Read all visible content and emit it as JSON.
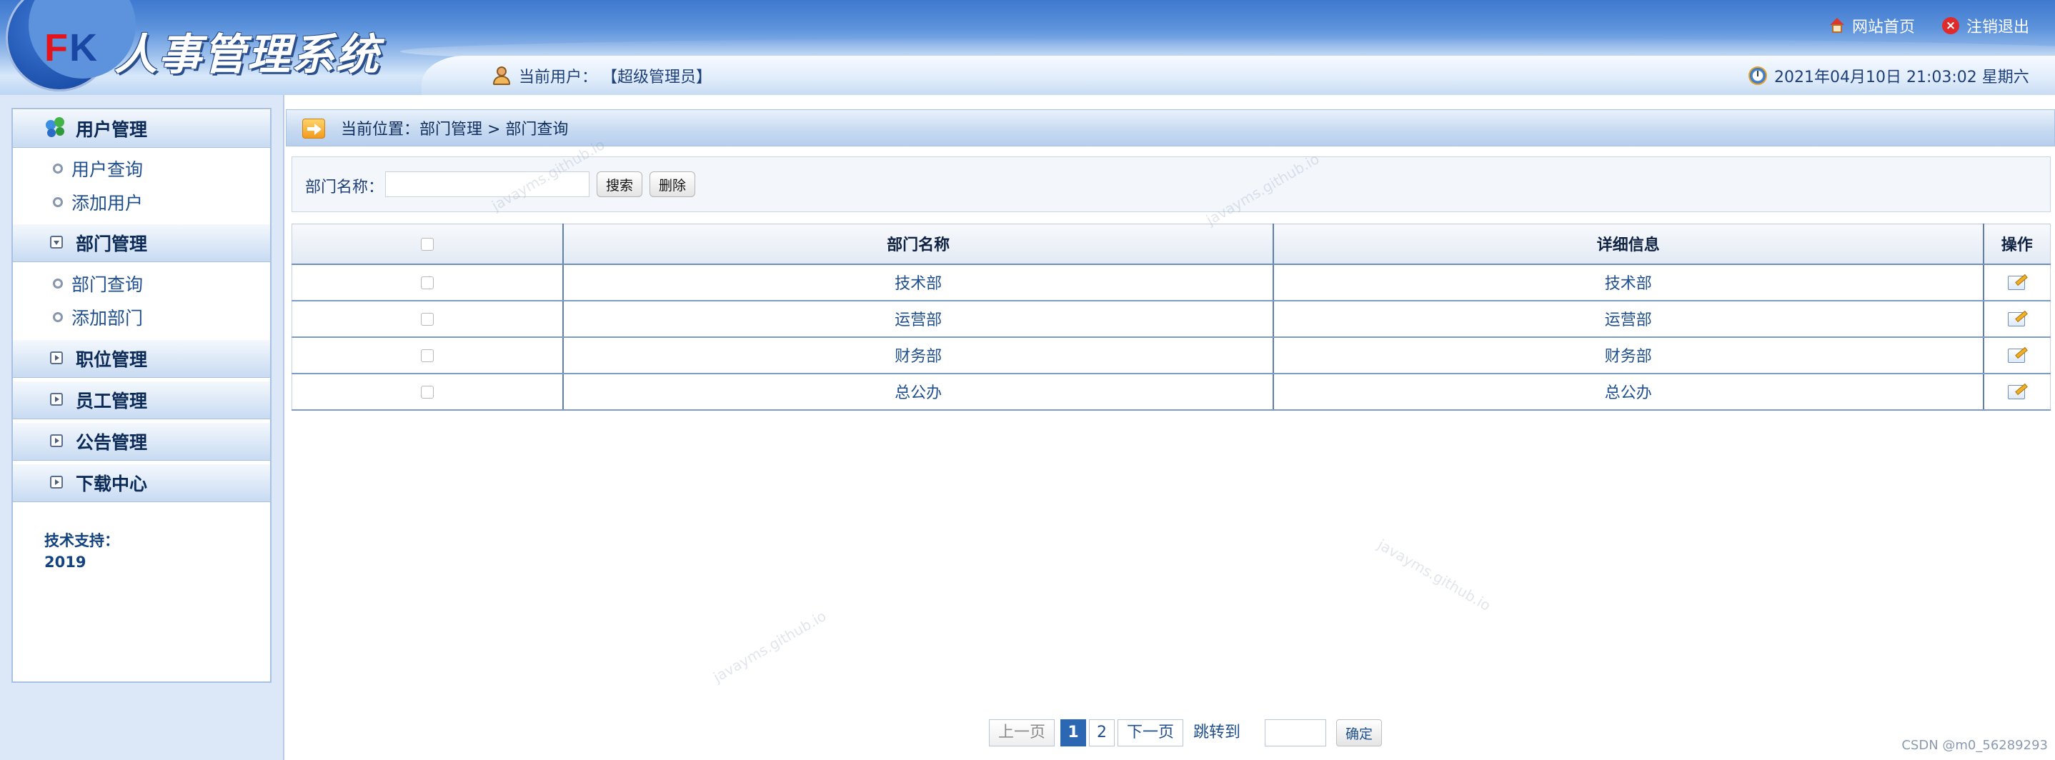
{
  "header": {
    "logo_f": "F",
    "logo_k": "K",
    "system_title": "人事管理系统",
    "home_link": "网站首页",
    "logout_link": "注销退出",
    "current_user_label": "当前用户：",
    "current_user_value": "【超级管理员】",
    "datetime": "2021年04月10日 21:03:02 星期六"
  },
  "sidebar": {
    "menus": [
      {
        "label": "用户管理",
        "icon": "users-icon",
        "expanded": true,
        "items": [
          "用户查询",
          "添加用户"
        ]
      },
      {
        "label": "部门管理",
        "icon": "collapse-icon",
        "expanded": true,
        "items": [
          "部门查询",
          "添加部门"
        ]
      },
      {
        "label": "职位管理",
        "icon": "expand-icon",
        "expanded": false
      },
      {
        "label": "员工管理",
        "icon": "expand-icon",
        "expanded": false
      },
      {
        "label": "公告管理",
        "icon": "expand-icon",
        "expanded": false
      },
      {
        "label": "下载中心",
        "icon": "expand-icon",
        "expanded": false
      }
    ],
    "tech_support_label": "技术支持：",
    "tech_support_value": "2019"
  },
  "breadcrumb": "当前位置：部门管理 > 部门查询",
  "search": {
    "label": "部门名称：",
    "value": "",
    "search_button": "搜索",
    "delete_button": "删除"
  },
  "table": {
    "headers": [
      "",
      "部门名称",
      "详细信息",
      "操作"
    ],
    "rows": [
      {
        "name": "技术部",
        "detail": "技术部"
      },
      {
        "name": "运营部",
        "detail": "运营部"
      },
      {
        "name": "财务部",
        "detail": "财务部"
      },
      {
        "name": "总公办",
        "detail": "总公办"
      }
    ]
  },
  "pagination": {
    "prev": "上一页",
    "pages": [
      "1",
      "2"
    ],
    "current_page": "1",
    "next": "下一页",
    "jump_label": "跳转到",
    "jump_value": "",
    "confirm": "确定"
  },
  "watermark_text": "javayms.github.io",
  "footer_credit": "CSDN @m0_56289293"
}
